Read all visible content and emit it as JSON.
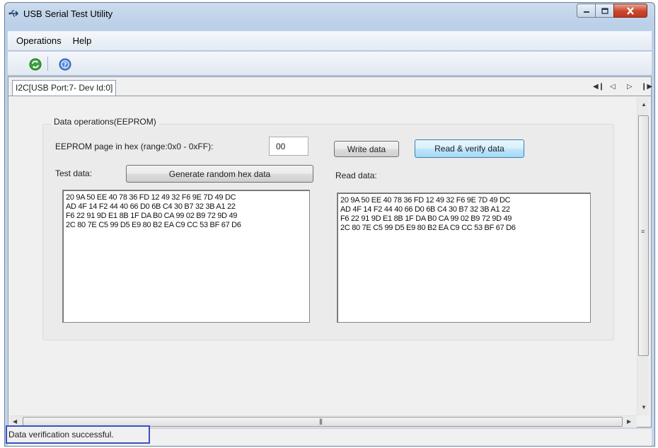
{
  "window": {
    "title": "USB Serial Test Utility",
    "app_icon": "usb-trident-icon",
    "controls": [
      "minimize-icon",
      "maximize-icon",
      "close-icon"
    ]
  },
  "menu": {
    "items": [
      "Operations",
      "Help"
    ]
  },
  "toolbar": {
    "icons": [
      "refresh-icon",
      "help-icon"
    ]
  },
  "tab": {
    "label": "I2C[USB Port:7- Dev Id:0]",
    "nav_icons": [
      "first-tab-icon",
      "prev-tab-icon",
      "next-tab-icon",
      "last-tab-icon"
    ]
  },
  "eeprom": {
    "group_title": "Data operations(EEPROM)",
    "page_label": "EEPROM page in hex (range:0x0 - 0xFF):",
    "page_value": "00",
    "write_button": "Write data",
    "read_verify_button": "Read & verify data",
    "test_data_label": "Test data:",
    "generate_button": "Generate random hex data",
    "read_data_label": "Read data:",
    "test_data_lines": [
      "20 9A 50 EE 40 78 36 FD 12 49 32 F6 9E 7D 49 DC",
      "AD 4F 14 F2 44 40 66 D0 6B C4 30 B7 32 3B A1 22",
      "F6 22 91 9D E1 8B 1F DA B0 CA 99 02 B9 72 9D 49",
      "2C 80 7E C5 99 D5 E9 80 B2 EA C9 CC 53 BF 67 D6"
    ],
    "read_data_lines": [
      "20 9A 50 EE 40 78 36 FD 12 49 32 F6 9E 7D 49 DC",
      "AD 4F 14 F2 44 40 66 D0 6B C4 30 B7 32 3B A1 22",
      "F6 22 91 9D E1 8B 1F DA B0 CA 99 02 B9 72 9D 49",
      "2C 80 7E C5 99 D5 E9 80 B2 EA C9 CC 53 BF 67 D6"
    ]
  },
  "status": {
    "text": "Data verification successful."
  },
  "colors": {
    "status_border": "#3a52c4",
    "focused_button": "#3c7fb1",
    "close_button": "#c9462c"
  }
}
